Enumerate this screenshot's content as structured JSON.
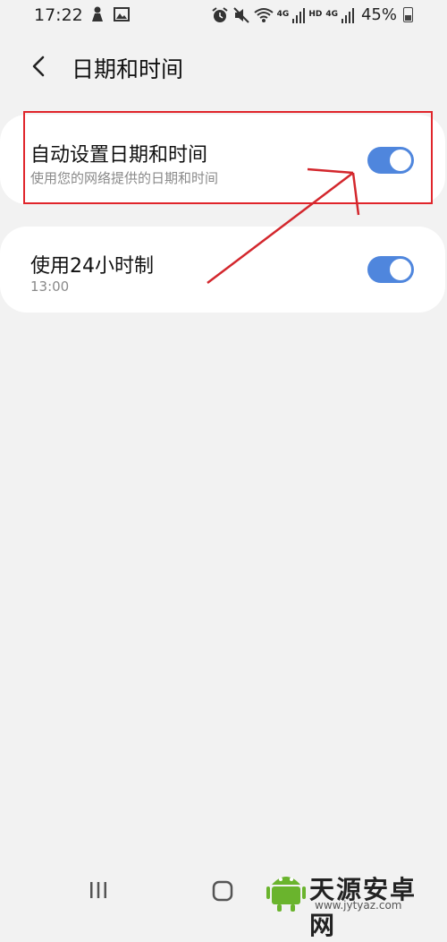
{
  "status_bar": {
    "time": "17:22",
    "signal_1_tag": "4G",
    "hd_tag": "HD",
    "signal_2_tag": "4G",
    "battery": "45%"
  },
  "header": {
    "title": "日期和时间"
  },
  "settings": [
    {
      "title": "自动设置日期和时间",
      "subtitle": "使用您的网络提供的日期和时间",
      "enabled": true
    },
    {
      "title": "使用24小时制",
      "subtitle": "13:00",
      "enabled": true
    }
  ],
  "colors": {
    "toggle_on": "#4f86dd",
    "annotation_red": "#e0252b",
    "background": "#f2f2f2"
  },
  "watermark": {
    "title": "天源安卓网",
    "url": "www.jytyaz.com"
  }
}
